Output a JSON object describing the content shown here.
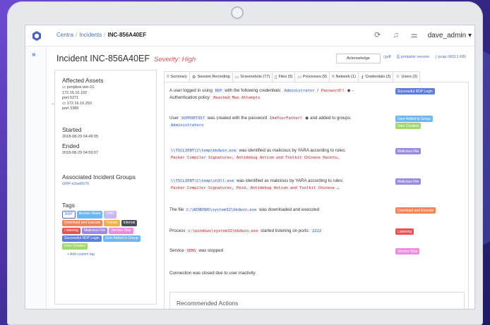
{
  "breadcrumb": {
    "root": "Centra",
    "section": "Incidents",
    "current": "INC-856A40EF"
  },
  "user": {
    "name": "dave_admin"
  },
  "incident": {
    "title": "Incident INC-856A40EF",
    "severity": "Severity: High"
  },
  "actions": {
    "acknowledge": "Acknowledge",
    "pdf": "pdf",
    "printable": "printable version",
    "pcap": "pcap (803.1 KB)"
  },
  "tabs": [
    {
      "label": "Summary",
      "icon": "summary-icon",
      "glyph": "≡"
    },
    {
      "label": "Session Recording",
      "icon": "gear-icon",
      "glyph": "⚙"
    },
    {
      "label": "Screenshots (77)",
      "icon": "monitor-icon",
      "glyph": "▭"
    },
    {
      "label": "Files (5)",
      "icon": "file-icon",
      "glyph": "▯"
    },
    {
      "label": "Processes (9)",
      "icon": "window-icon",
      "glyph": "▭"
    },
    {
      "label": "Network (1)",
      "icon": "network-icon",
      "glyph": "≡"
    },
    {
      "label": "Credentials (3)",
      "icon": "key-icon",
      "glyph": "⚷"
    },
    {
      "label": "Users (2)",
      "icon": "users-icon",
      "glyph": "☺"
    }
  ],
  "sidebar": {
    "assets_title": "Affected Assets",
    "asset1_name": "jumpbox-win-01",
    "asset1_ip": "172.16.10.102",
    "asset1_port": "port 5271",
    "asset2_ip": "172.16.10.250",
    "asset2_port": "port 3389",
    "started_label": "Started",
    "started_value": "2018-08-29 04:49:05",
    "ended_label": "Ended",
    "ended_value": "2018-08-29 04:59:07",
    "groups_title": "Associated Incident Groups",
    "group_link": "GRP-e3aeb576",
    "tags_title": "Tags",
    "tags": [
      {
        "label": "RDP",
        "color": "#ffffff",
        "outline": true
      },
      {
        "label": "Access Share",
        "color": "#6fb6f2"
      },
      {
        "label": "CMD",
        "color": "#c9b8f0"
      },
      {
        "label": "Download and Execute",
        "color": "#f0855a"
      },
      {
        "label": "Human",
        "color": "#f5b041"
      },
      {
        "label": "Internal",
        "color": "#4a4f58"
      },
      {
        "label": "Listening",
        "color": "#e55353"
      },
      {
        "label": "Malicious File",
        "color": "#9b8be0"
      },
      {
        "label": "Service Stop",
        "color": "#e98de0"
      },
      {
        "label": "Successful RDP Login",
        "color": "#5c7de0"
      },
      {
        "label": "User Added to Group",
        "color": "#6fb6f2"
      },
      {
        "label": "User Created",
        "color": "#9fd86b"
      }
    ],
    "add_tag": "+ Add custom tag"
  },
  "events": [
    {
      "parts": [
        "A user logged in using ",
        "RDP",
        " with the following credentials: ",
        "Administrator",
        " / ",
        "Password!!",
        " ◉ -",
        "Authentication policy: ",
        "Reached Max Attempts"
      ],
      "badge": "Successful RDP Login",
      "badge_color": "#5c7de0"
    },
    {
      "parts": [
        "User ",
        "SUPPORT357",
        " was created with the password ",
        "IAmYourFather!",
        " ◉ and added to groups:",
        "Administrators"
      ],
      "badge": "User Added to Group",
      "badge_color": "#6fb6f2",
      "badge2": "User Created",
      "badge2_color": "#9fd86b"
    },
    {
      "parts": [
        "\\\\TSCLIENT\\C\\temp\\bkdwin.exe",
        " was identified as malicious by YARA according to rules:",
        "Packer Compiler Signatures, Antidebug Antivm and Toolkit Chinese Hackto…"
      ],
      "badge": "Malicious File",
      "badge_color": "#9b8be0"
    },
    {
      "parts": [
        "\\\\TSCLIENT\\C\\temp\\sh3ll.exe",
        " was identified as malicious by YARA according to rules:",
        "Packer Compiler Signatures, Peid, Antidebug Antivm and Toolkit Chinese …"
      ],
      "badge": "Malicious File",
      "badge_color": "#9b8be0"
    },
    {
      "parts": [
        "The file ",
        "C:\\WINDOWS\\system32\\bkdwin.exe",
        " was downloaded and executed"
      ],
      "badge": "Download and Execute",
      "badge_color": "#f0855a"
    },
    {
      "parts": [
        "Process ",
        "c:\\windows\\system32\\bkdwin.exe",
        " started listening on ports: ",
        "2222"
      ],
      "badge": "Listening",
      "badge_color": "#e55353"
    },
    {
      "parts": [
        "Service ",
        "SENS",
        " was stopped"
      ],
      "badge": "Service Stop",
      "badge_color": "#e98de0"
    },
    {
      "parts": [
        "Connection was closed due to user inactivity"
      ]
    }
  ],
  "recommended": {
    "title": "Recommended Actions"
  }
}
